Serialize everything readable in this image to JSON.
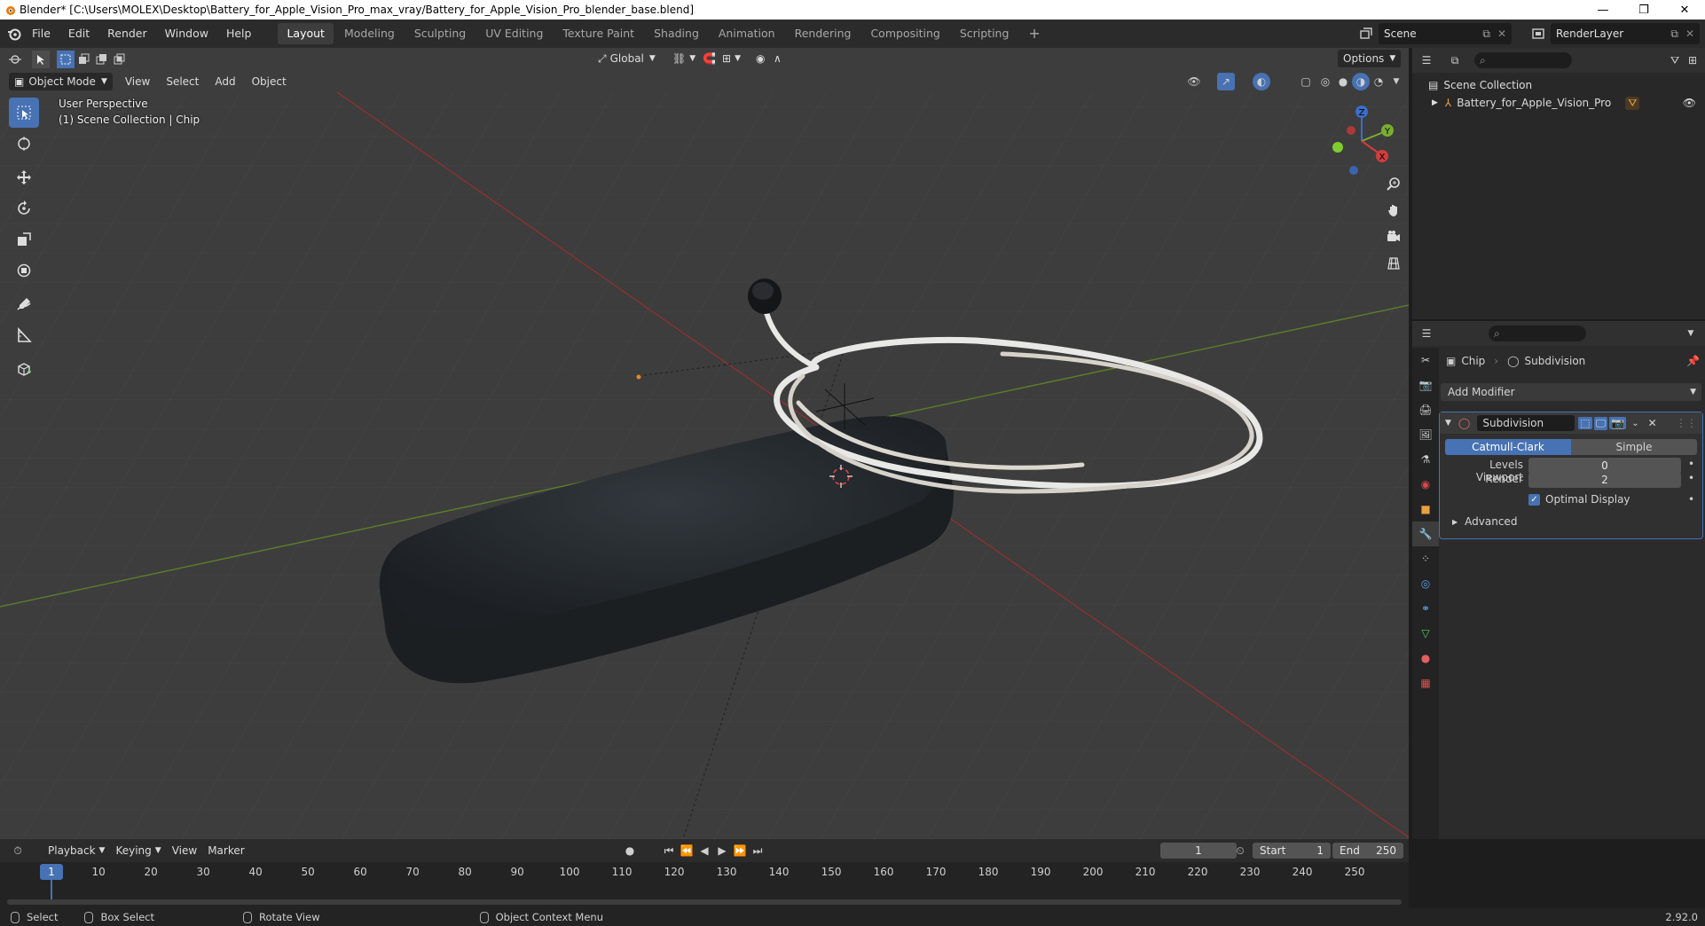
{
  "titlebar": {
    "title": "Blender* [C:\\Users\\MOLEX\\Desktop\\Battery_for_Apple_Vision_Pro_max_vray/Battery_for_Apple_Vision_Pro_blender_base.blend]",
    "minimize": "—",
    "maximize": "❐",
    "close": "✕"
  },
  "menu": {
    "file": "File",
    "edit": "Edit",
    "render": "Render",
    "window": "Window",
    "help": "Help"
  },
  "workspaces": [
    "Layout",
    "Modeling",
    "Sculpting",
    "UV Editing",
    "Texture Paint",
    "Shading",
    "Animation",
    "Rendering",
    "Compositing",
    "Scripting"
  ],
  "workspace_add": "+",
  "scene": {
    "name": "Scene",
    "view_layer": "RenderLayer"
  },
  "viewport": {
    "mode": "Object Mode",
    "view": "View",
    "select": "Select",
    "add": "Add",
    "object": "Object",
    "transform_orientation": "Global",
    "options": "Options",
    "perspective_text": "User Perspective",
    "collection_text": "(1) Scene Collection | Chip",
    "gizmo": {
      "x": "X",
      "y": "Y",
      "z": "Z"
    }
  },
  "outliner": {
    "scene_collection": "Scene Collection",
    "object": "Battery_for_Apple_Vision_Pro"
  },
  "properties": {
    "object": "Chip",
    "modifier_breadcrumb": "Subdivision",
    "add_modifier": "Add Modifier",
    "modifier_name": "Subdivision",
    "catmull_clark": "Catmull-Clark",
    "simple": "Simple",
    "levels_viewport_label": "Levels Viewport",
    "levels_viewport_value": "0",
    "render_label": "Render",
    "render_value": "2",
    "optimal_display": "Optimal Display",
    "advanced": "Advanced"
  },
  "timeline": {
    "playback": "Playback",
    "keying": "Keying",
    "view": "View",
    "marker": "Marker",
    "current_frame": "1",
    "start_label": "Start",
    "start_value": "1",
    "end_label": "End",
    "end_value": "250",
    "ruler": [
      "1",
      "10",
      "20",
      "30",
      "40",
      "50",
      "60",
      "70",
      "80",
      "90",
      "100",
      "110",
      "120",
      "130",
      "140",
      "150",
      "160",
      "170",
      "180",
      "190",
      "200",
      "210",
      "220",
      "230",
      "240",
      "250"
    ]
  },
  "statusbar": {
    "select": "Select",
    "box_select": "Box Select",
    "rotate_view": "Rotate View",
    "context_menu": "Object Context Menu",
    "version": "2.92.0"
  }
}
